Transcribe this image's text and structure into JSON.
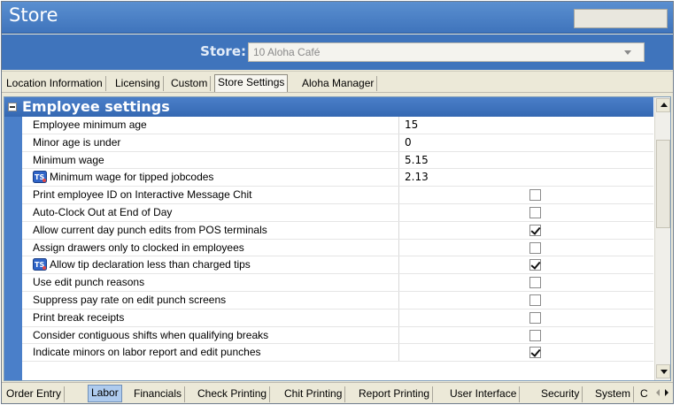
{
  "window": {
    "title": "Store"
  },
  "store_selector": {
    "label": "Store:",
    "value": "10 Aloha Café"
  },
  "top_tabs": [
    {
      "label": "Location Information",
      "active": false
    },
    {
      "label": "Licensing",
      "active": false
    },
    {
      "label": "Custom",
      "active": false
    },
    {
      "label": "Store Settings",
      "active": true
    },
    {
      "label": "Aloha Manager",
      "active": false
    }
  ],
  "section": {
    "title": "Employee settings",
    "rows": [
      {
        "label": "Employee minimum age",
        "value": "15"
      },
      {
        "label": "Minor age is under",
        "value": "0"
      },
      {
        "label": "Minimum wage",
        "value": "5.15"
      },
      {
        "label": "Minimum wage for tipped jobcodes",
        "value": "2.13",
        "icon": "ts-icon"
      },
      {
        "label": "Print employee ID on Interactive Message Chit",
        "checked": false
      },
      {
        "label": "Auto-Clock Out at End of Day",
        "checked": false
      },
      {
        "label": "Allow current day punch edits from POS terminals",
        "checked": true
      },
      {
        "label": "Assign drawers only to clocked in employees",
        "checked": false
      },
      {
        "label": "Allow tip declaration less than charged tips",
        "checked": true,
        "icon": "ts-icon"
      },
      {
        "label": "Use edit punch reasons",
        "checked": false
      },
      {
        "label": "Suppress pay rate on edit punch screens",
        "checked": false
      },
      {
        "label": "Print break receipts",
        "checked": false
      },
      {
        "label": "Consider contiguous shifts when qualifying breaks",
        "checked": false
      },
      {
        "label": "Indicate minors on labor report and edit punches",
        "checked": true
      }
    ]
  },
  "bottom_tabs": [
    {
      "label": "Order Entry",
      "active": false
    },
    {
      "label": "Labor",
      "active": true
    },
    {
      "label": "Financials",
      "active": false
    },
    {
      "label": "Check Printing",
      "active": false
    },
    {
      "label": "Chit Printing",
      "active": false
    },
    {
      "label": "Report Printing",
      "active": false
    },
    {
      "label": "User Interface",
      "active": false
    },
    {
      "label": "Security",
      "active": false
    },
    {
      "label": "System",
      "active": false
    },
    {
      "label": "C",
      "active": false
    }
  ],
  "colors": {
    "header_blue": "#3f74bc",
    "active_bottom_tab": "#aecbee"
  }
}
